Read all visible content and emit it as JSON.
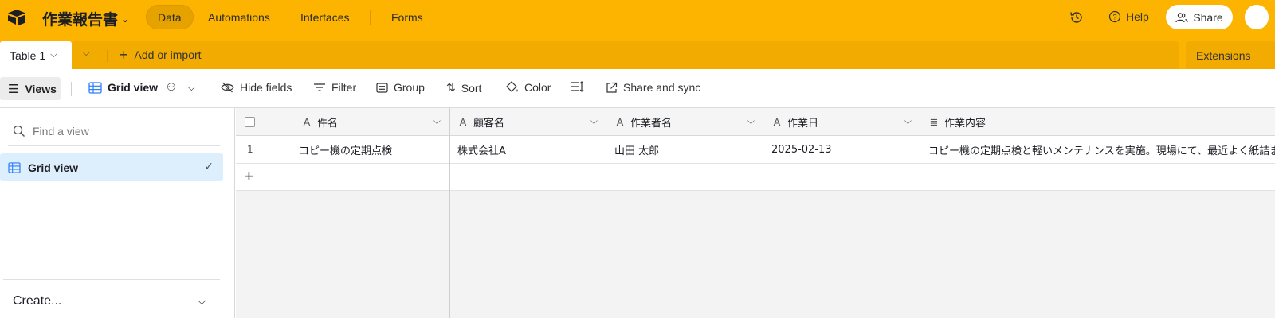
{
  "app": {
    "base_name": "作業報告書",
    "nav": [
      {
        "label": "Data",
        "active": true
      },
      {
        "label": "Automations",
        "active": false
      },
      {
        "label": "Interfaces",
        "active": false
      },
      {
        "label": "Forms",
        "active": false
      }
    ],
    "help_label": "Help",
    "share_label": "Share",
    "accent": "#fcb400"
  },
  "tablebar": {
    "table_name": "Table 1",
    "add_import_label": "Add or import",
    "extensions_label": "Extensions"
  },
  "toolbar": {
    "views_label": "Views",
    "grid_view_label": "Grid view",
    "hide_fields_label": "Hide fields",
    "filter_label": "Filter",
    "group_label": "Group",
    "sort_label": "Sort",
    "color_label": "Color",
    "share_sync_label": "Share and sync"
  },
  "sidebar": {
    "find_placeholder": "Find a view",
    "views": [
      {
        "label": "Grid view",
        "selected": true
      }
    ],
    "create_label": "Create..."
  },
  "grid": {
    "columns": [
      {
        "label": "件名",
        "type_icon": "A"
      },
      {
        "label": "顧客名",
        "type_icon": "A"
      },
      {
        "label": "作業者名",
        "type_icon": "A"
      },
      {
        "label": "作業日",
        "type_icon": "A"
      },
      {
        "label": "作業内容",
        "type_icon": "≣"
      }
    ],
    "rows": [
      {
        "num": "1",
        "cells": [
          "コピー機の定期点検",
          "株式会社A",
          "山田 太郎",
          "2025-02-13",
          "コピー機の定期点検と軽いメンテナンスを実施。現場にて、最近よく紙詰まりが発生するとの"
        ]
      }
    ]
  }
}
